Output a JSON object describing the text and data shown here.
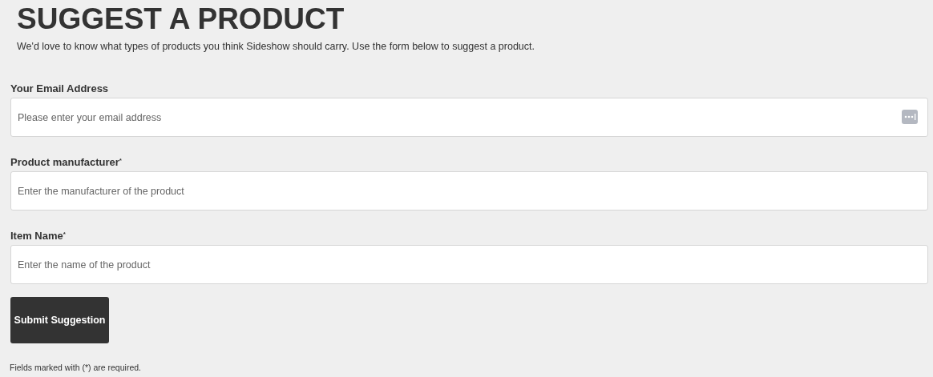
{
  "title": "SUGGEST A PRODUCT",
  "intro": "We'd love to know what types of products you think Sideshow should carry. Use the form below to suggest a product.",
  "fields": [
    {
      "label": "Your Email Address",
      "placeholder": "Please enter your email address",
      "autofill_icon": true
    },
    {
      "label": "Product manufacturer$^{*}$",
      "placeholder": "Enter the manufacturer of the product",
      "autofill_icon": false
    },
    {
      "label": "Item Name$^{*}$",
      "placeholder": "Enter the name of the product",
      "autofill_icon": false
    }
  ],
  "submit": "Submit Suggestion",
  "footnote": "Fields marked with (*) are required."
}
